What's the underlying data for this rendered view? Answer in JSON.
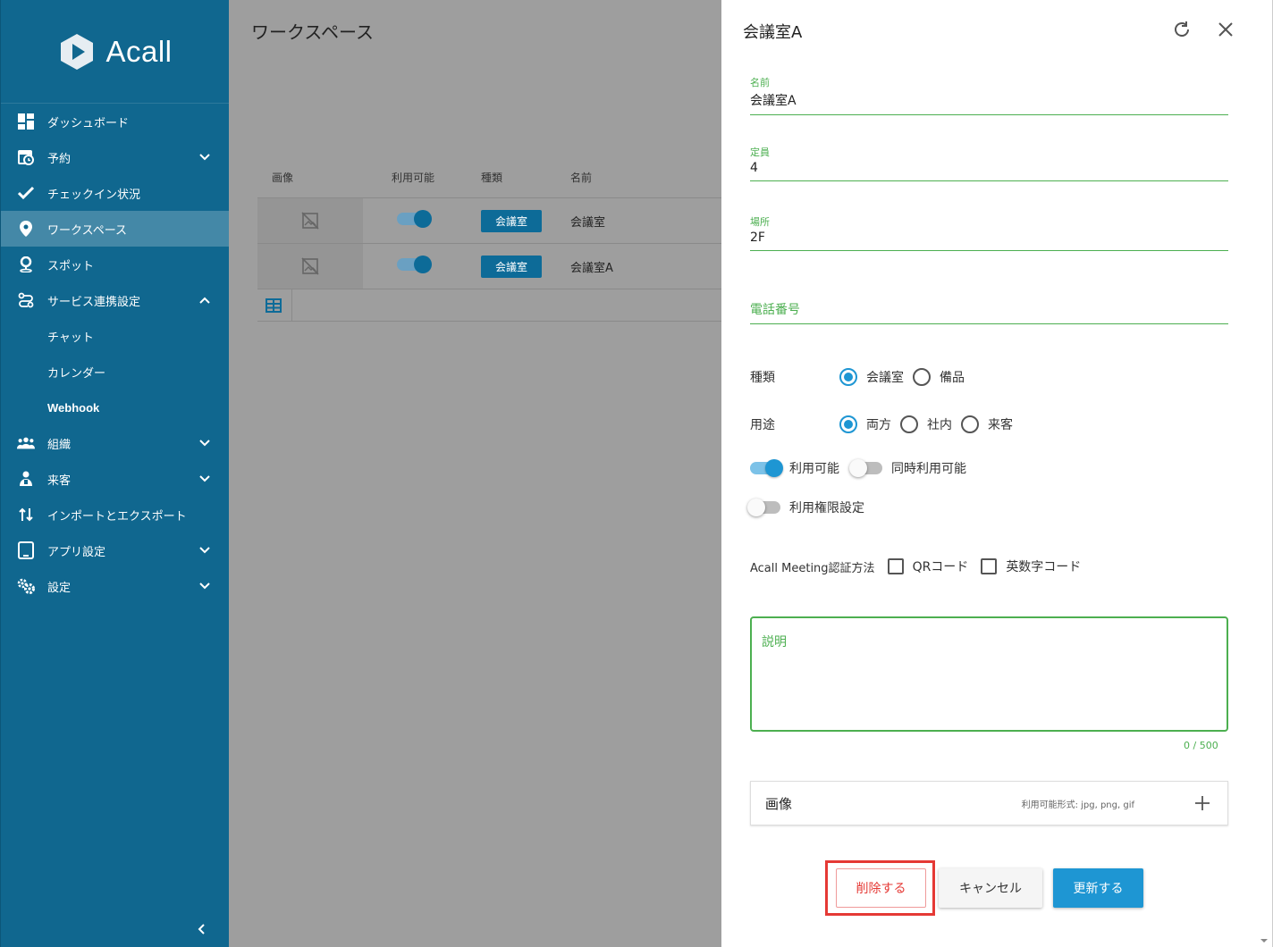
{
  "brand": {
    "name": "Acall"
  },
  "sidebar": {
    "items": [
      {
        "label": "ダッシュボード",
        "icon": "dashboard-icon"
      },
      {
        "label": "予約",
        "icon": "calendar-clock-icon"
      },
      {
        "label": "チェックイン状況",
        "icon": "check-icon"
      },
      {
        "label": "ワークスペース",
        "icon": "location-pin-icon",
        "active": true
      },
      {
        "label": "スポット",
        "icon": "spot-pin-icon"
      },
      {
        "label": "サービス連携設定",
        "icon": "integration-icon"
      },
      {
        "label": "チャット"
      },
      {
        "label": "カレンダー"
      },
      {
        "label": "Webhook"
      },
      {
        "label": "組織",
        "icon": "group-icon"
      },
      {
        "label": "来客",
        "icon": "visitor-icon"
      },
      {
        "label": "インポートとエクスポート",
        "icon": "import-export-icon"
      },
      {
        "label": "アプリ設定",
        "icon": "tablet-icon"
      },
      {
        "label": "設定",
        "icon": "settings-gears-icon"
      }
    ]
  },
  "main": {
    "title": "ワークスペース",
    "table": {
      "headers": [
        "画像",
        "利用可能",
        "種類",
        "名前"
      ],
      "rows": [
        {
          "available": true,
          "type": "会議室",
          "name": "会議室"
        },
        {
          "available": true,
          "type": "会議室",
          "name": "会議室A"
        }
      ]
    }
  },
  "drawer": {
    "title": "会議室A",
    "name": {
      "label": "名前",
      "value": "会議室A"
    },
    "capacity": {
      "label": "定員",
      "value": "4"
    },
    "location": {
      "label": "場所",
      "value": "2F"
    },
    "phone": {
      "placeholder": "電話番号",
      "value": ""
    },
    "type": {
      "label": "種類",
      "options": [
        "会議室",
        "備品"
      ],
      "selected": "会議室"
    },
    "usage": {
      "label": "用途",
      "options": [
        "両方",
        "社内",
        "来客"
      ],
      "selected": "両方"
    },
    "switches": {
      "available": {
        "label": "利用可能",
        "on": true
      },
      "concurrent": {
        "label": "同時利用可能",
        "on": false
      },
      "permission": {
        "label": "利用権限設定",
        "on": false
      }
    },
    "auth": {
      "label": "Acall Meeting認証方法",
      "options": [
        "QRコード",
        "英数字コード"
      ]
    },
    "description": {
      "label": "説明",
      "value": "",
      "counter": "0 / 500"
    },
    "image": {
      "label": "画像",
      "hint": "利用可能形式: jpg, png, gif"
    },
    "buttons": {
      "delete": "削除する",
      "cancel": "キャンセル",
      "update": "更新する"
    }
  },
  "colors": {
    "sidebar": "#10678f",
    "accent": "#1e96d3",
    "field_green": "#4caf50",
    "danger": "#e53935"
  }
}
